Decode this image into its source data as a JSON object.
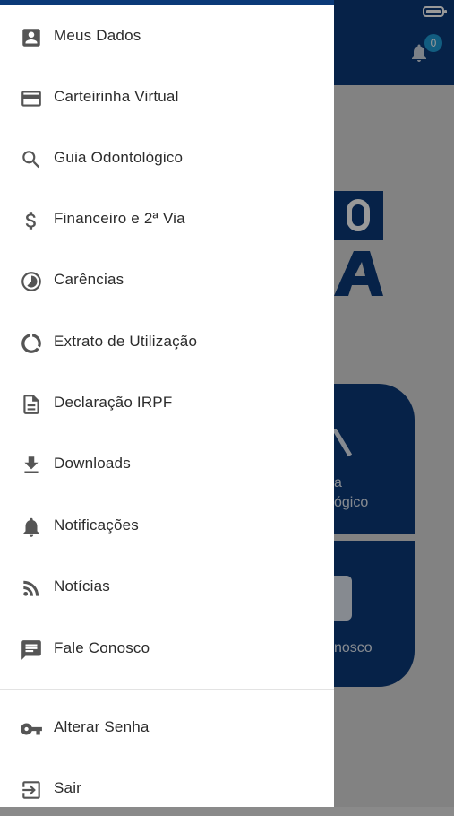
{
  "header": {
    "notification_count": "0"
  },
  "background": {
    "card1_label_line1": "a",
    "card1_label_line2": "ógico",
    "card2_label": "nosco"
  },
  "menu": {
    "items": [
      {
        "label": "Meus Dados",
        "icon": "account-box-icon"
      },
      {
        "label": "Carteirinha Virtual",
        "icon": "credit-card-icon"
      },
      {
        "label": "Guia Odontológico",
        "icon": "search-icon"
      },
      {
        "label": "Financeiro e 2ª Via",
        "icon": "dollar-icon"
      },
      {
        "label": "Carências",
        "icon": "timelapse-icon"
      },
      {
        "label": "Extrato de Utilização",
        "icon": "donut-icon"
      },
      {
        "label": "Declaração IRPF",
        "icon": "document-icon"
      },
      {
        "label": "Downloads",
        "icon": "download-icon"
      },
      {
        "label": "Notificações",
        "icon": "bell-icon"
      },
      {
        "label": "Notícias",
        "icon": "rss-icon"
      },
      {
        "label": "Fale Conosco",
        "icon": "chat-icon"
      }
    ],
    "secondary": [
      {
        "label": "Alterar Senha",
        "icon": "key-icon"
      },
      {
        "label": "Sair",
        "icon": "logout-icon"
      }
    ]
  },
  "colors": {
    "brand": "#0b3a78",
    "badge": "#1f9bd6",
    "text": "#2b2b2b",
    "icon": "#555555"
  }
}
